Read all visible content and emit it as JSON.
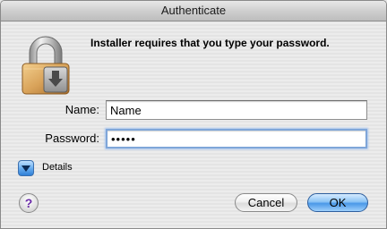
{
  "window": {
    "title": "Authenticate"
  },
  "message": "Installer requires that you type your password.",
  "form": {
    "name_label": "Name:",
    "name_value": "Name",
    "password_label": "Password:",
    "password_value": "•••••"
  },
  "details": {
    "label": "Details",
    "icon": "disclosure-triangle-icon"
  },
  "help": {
    "glyph": "?",
    "icon": "help-icon"
  },
  "buttons": {
    "cancel_label": "Cancel",
    "ok_label": "OK"
  },
  "icons": {
    "lock": "lock-icon"
  },
  "colors": {
    "default_button": "#4a98e8",
    "focus_ring": "#7fa6d9",
    "disclosure": "#2f80d6",
    "help_glyph": "#6a2aa8"
  }
}
